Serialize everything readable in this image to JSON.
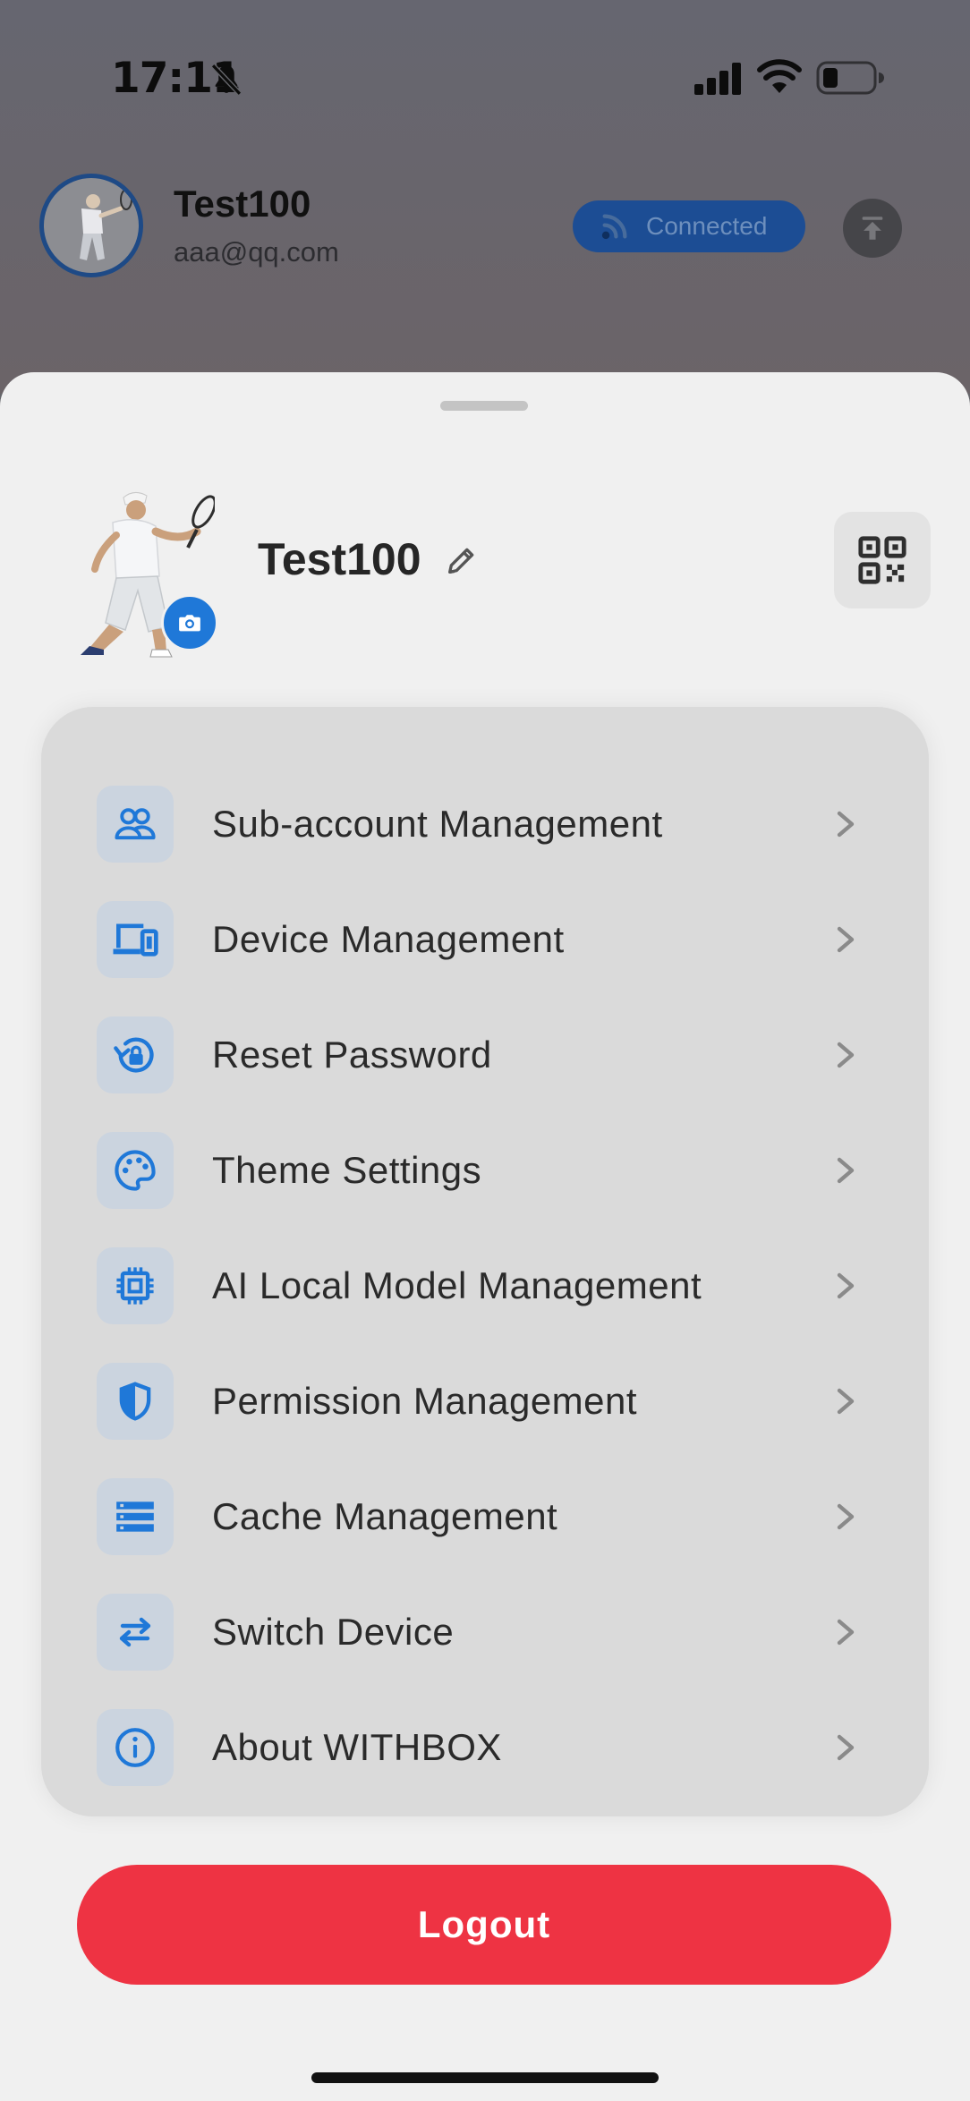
{
  "status_bar": {
    "time": "17:11",
    "icons": [
      "bell-slash-icon",
      "signal-icon",
      "wifi-icon",
      "battery-icon"
    ]
  },
  "background_header": {
    "username": "Test100",
    "email": "aaa@qq.com",
    "connection_status": "Connected",
    "connection_icon": "rss-icon",
    "upload_icon": "upload-icon"
  },
  "profile": {
    "name": "Test100",
    "camera_icon": "camera-icon",
    "edit_icon": "pencil-icon",
    "qr_icon": "qr-code-icon"
  },
  "menu": {
    "items": [
      {
        "label": "Sub-account Management",
        "icon": "users-icon"
      },
      {
        "label": "Device Management",
        "icon": "devices-icon"
      },
      {
        "label": "Reset Password",
        "icon": "reset-lock-icon"
      },
      {
        "label": "Theme Settings",
        "icon": "palette-icon"
      },
      {
        "label": "AI Local Model Management",
        "icon": "chip-icon"
      },
      {
        "label": "Permission Management",
        "icon": "shield-icon"
      },
      {
        "label": "Cache Management",
        "icon": "list-icon"
      },
      {
        "label": "Switch Device",
        "icon": "switch-arrows-icon"
      },
      {
        "label": "About WITHBOX",
        "icon": "info-icon"
      }
    ]
  },
  "logout": {
    "label": "Logout"
  },
  "colors": {
    "accent": "#1f78d8",
    "logout": "#ee3343",
    "sheet": "#f0f0f0",
    "card": "#dadada",
    "icon_box": "#cbd4df"
  }
}
